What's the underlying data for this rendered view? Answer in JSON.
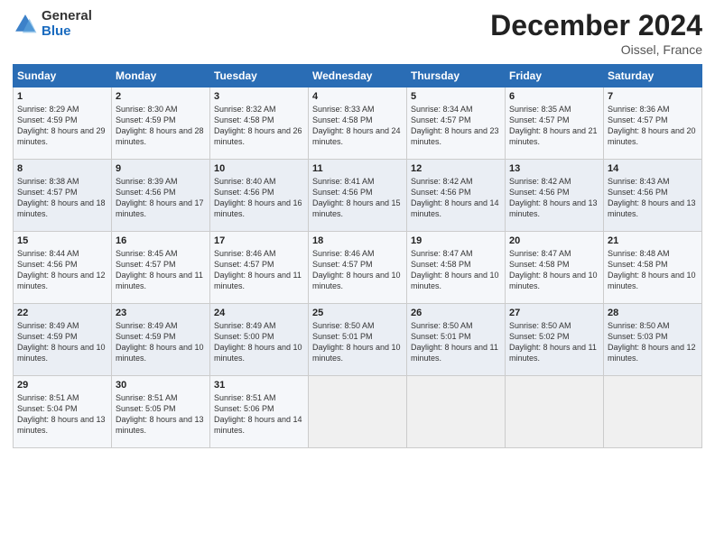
{
  "header": {
    "logo_general": "General",
    "logo_blue": "Blue",
    "title": "December 2024",
    "location": "Oissel, France"
  },
  "days_of_week": [
    "Sunday",
    "Monday",
    "Tuesday",
    "Wednesday",
    "Thursday",
    "Friday",
    "Saturday"
  ],
  "weeks": [
    [
      {
        "day": "1",
        "sunrise": "8:29 AM",
        "sunset": "4:59 PM",
        "daylight": "8 hours and 29 minutes."
      },
      {
        "day": "2",
        "sunrise": "8:30 AM",
        "sunset": "4:59 PM",
        "daylight": "8 hours and 28 minutes."
      },
      {
        "day": "3",
        "sunrise": "8:32 AM",
        "sunset": "4:58 PM",
        "daylight": "8 hours and 26 minutes."
      },
      {
        "day": "4",
        "sunrise": "8:33 AM",
        "sunset": "4:58 PM",
        "daylight": "8 hours and 24 minutes."
      },
      {
        "day": "5",
        "sunrise": "8:34 AM",
        "sunset": "4:57 PM",
        "daylight": "8 hours and 23 minutes."
      },
      {
        "day": "6",
        "sunrise": "8:35 AM",
        "sunset": "4:57 PM",
        "daylight": "8 hours and 21 minutes."
      },
      {
        "day": "7",
        "sunrise": "8:36 AM",
        "sunset": "4:57 PM",
        "daylight": "8 hours and 20 minutes."
      }
    ],
    [
      {
        "day": "8",
        "sunrise": "8:38 AM",
        "sunset": "4:57 PM",
        "daylight": "8 hours and 18 minutes."
      },
      {
        "day": "9",
        "sunrise": "8:39 AM",
        "sunset": "4:56 PM",
        "daylight": "8 hours and 17 minutes."
      },
      {
        "day": "10",
        "sunrise": "8:40 AM",
        "sunset": "4:56 PM",
        "daylight": "8 hours and 16 minutes."
      },
      {
        "day": "11",
        "sunrise": "8:41 AM",
        "sunset": "4:56 PM",
        "daylight": "8 hours and 15 minutes."
      },
      {
        "day": "12",
        "sunrise": "8:42 AM",
        "sunset": "4:56 PM",
        "daylight": "8 hours and 14 minutes."
      },
      {
        "day": "13",
        "sunrise": "8:42 AM",
        "sunset": "4:56 PM",
        "daylight": "8 hours and 13 minutes."
      },
      {
        "day": "14",
        "sunrise": "8:43 AM",
        "sunset": "4:56 PM",
        "daylight": "8 hours and 13 minutes."
      }
    ],
    [
      {
        "day": "15",
        "sunrise": "8:44 AM",
        "sunset": "4:56 PM",
        "daylight": "8 hours and 12 minutes."
      },
      {
        "day": "16",
        "sunrise": "8:45 AM",
        "sunset": "4:57 PM",
        "daylight": "8 hours and 11 minutes."
      },
      {
        "day": "17",
        "sunrise": "8:46 AM",
        "sunset": "4:57 PM",
        "daylight": "8 hours and 11 minutes."
      },
      {
        "day": "18",
        "sunrise": "8:46 AM",
        "sunset": "4:57 PM",
        "daylight": "8 hours and 10 minutes."
      },
      {
        "day": "19",
        "sunrise": "8:47 AM",
        "sunset": "4:58 PM",
        "daylight": "8 hours and 10 minutes."
      },
      {
        "day": "20",
        "sunrise": "8:47 AM",
        "sunset": "4:58 PM",
        "daylight": "8 hours and 10 minutes."
      },
      {
        "day": "21",
        "sunrise": "8:48 AM",
        "sunset": "4:58 PM",
        "daylight": "8 hours and 10 minutes."
      }
    ],
    [
      {
        "day": "22",
        "sunrise": "8:49 AM",
        "sunset": "4:59 PM",
        "daylight": "8 hours and 10 minutes."
      },
      {
        "day": "23",
        "sunrise": "8:49 AM",
        "sunset": "4:59 PM",
        "daylight": "8 hours and 10 minutes."
      },
      {
        "day": "24",
        "sunrise": "8:49 AM",
        "sunset": "5:00 PM",
        "daylight": "8 hours and 10 minutes."
      },
      {
        "day": "25",
        "sunrise": "8:50 AM",
        "sunset": "5:01 PM",
        "daylight": "8 hours and 10 minutes."
      },
      {
        "day": "26",
        "sunrise": "8:50 AM",
        "sunset": "5:01 PM",
        "daylight": "8 hours and 11 minutes."
      },
      {
        "day": "27",
        "sunrise": "8:50 AM",
        "sunset": "5:02 PM",
        "daylight": "8 hours and 11 minutes."
      },
      {
        "day": "28",
        "sunrise": "8:50 AM",
        "sunset": "5:03 PM",
        "daylight": "8 hours and 12 minutes."
      }
    ],
    [
      {
        "day": "29",
        "sunrise": "8:51 AM",
        "sunset": "5:04 PM",
        "daylight": "8 hours and 13 minutes."
      },
      {
        "day": "30",
        "sunrise": "8:51 AM",
        "sunset": "5:05 PM",
        "daylight": "8 hours and 13 minutes."
      },
      {
        "day": "31",
        "sunrise": "8:51 AM",
        "sunset": "5:06 PM",
        "daylight": "8 hours and 14 minutes."
      },
      null,
      null,
      null,
      null
    ]
  ]
}
